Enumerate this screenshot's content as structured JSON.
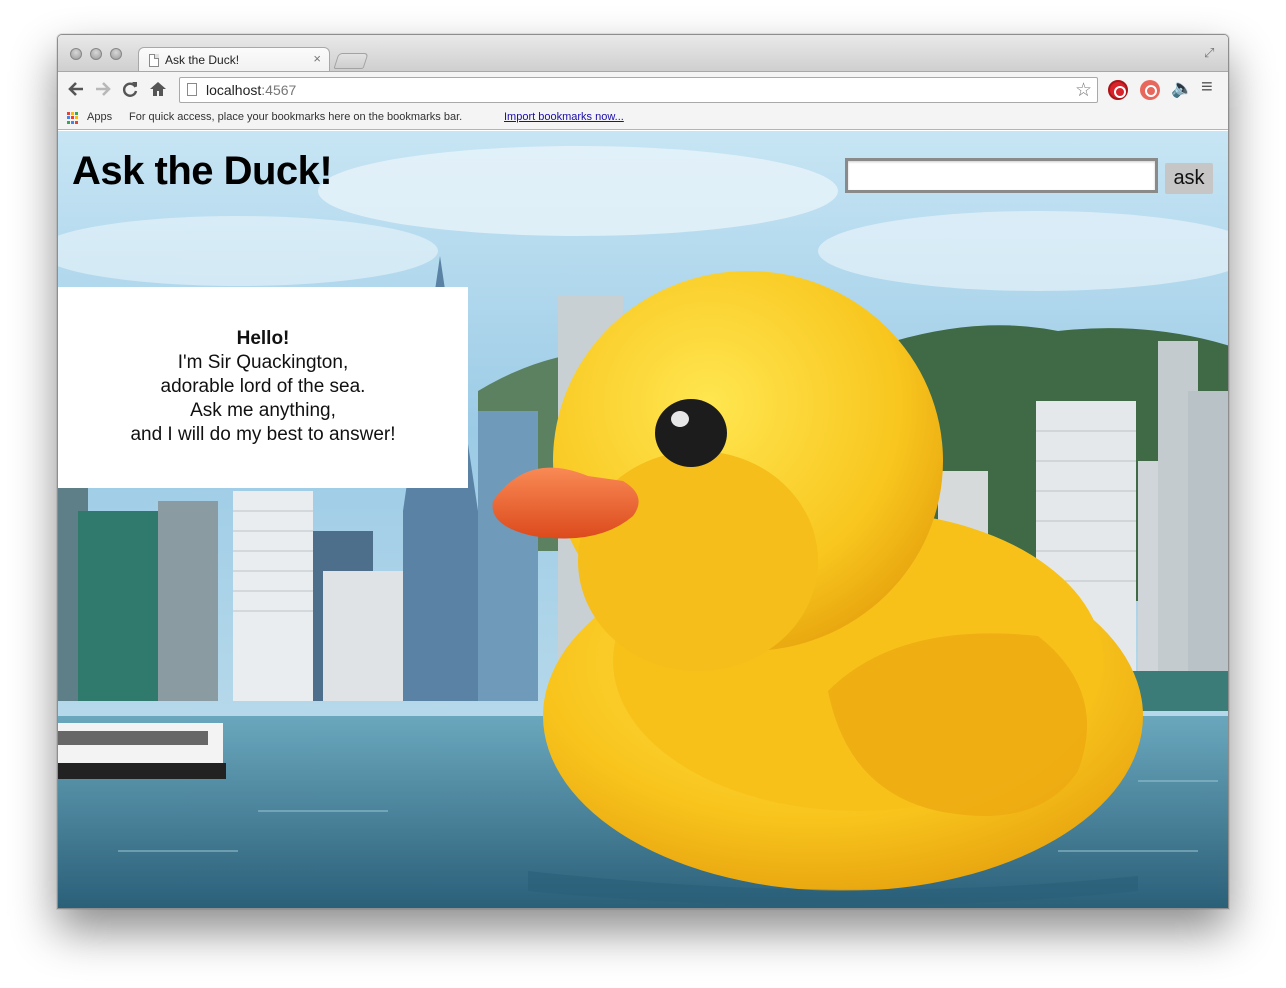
{
  "browser": {
    "tab_title": "Ask the Duck!",
    "tab_close": "×",
    "url_host": "localhost",
    "url_port": ":4567",
    "bookmarks": {
      "apps_label": "Apps",
      "hint": "For quick access, place your bookmarks here on the bookmarks bar.",
      "import_link": "Import bookmarks now..."
    },
    "icons": {
      "back": "back-arrow-icon",
      "forward": "forward-arrow-icon",
      "reload": "reload-icon",
      "home": "home-icon",
      "star": "bookmark-star-icon",
      "menu": "hamburger-menu-icon"
    }
  },
  "page": {
    "title": "Ask the Duck!",
    "search": {
      "value": "",
      "button_label": "ask"
    },
    "card": {
      "greeting": "Hello!",
      "lines": [
        "I'm Sir Quackington,",
        "adorable lord of the sea.",
        "Ask me anything,",
        "and I will do my best to answer!"
      ]
    },
    "background": "rubber-duck-harbor-photo"
  },
  "colors": {
    "duck_yellow": "#f7c520",
    "beak_orange": "#f0672e",
    "sky": "#a8d3ea",
    "water": "#3d7f97",
    "button_gray": "#c6c6c6"
  }
}
